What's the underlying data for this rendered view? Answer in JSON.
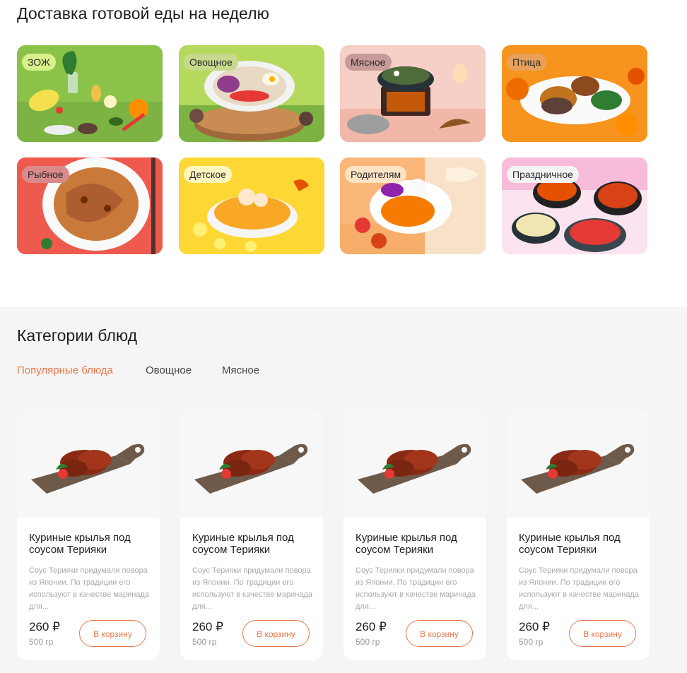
{
  "delivery": {
    "title": "Доставка готовой еды на неделю",
    "categories": [
      {
        "label": "ЗОЖ",
        "tag_color": "#d9f18a",
        "bg": "#8bc34a"
      },
      {
        "label": "Овощное",
        "tag_color": "#c7d98c",
        "bg": "#9ccc4f"
      },
      {
        "label": "Мясное",
        "tag_color": "#c99a9a",
        "bg": "#f4c6c0"
      },
      {
        "label": "Птица",
        "tag_color": "#e8a15a",
        "bg": "#f7941d"
      },
      {
        "label": "Рыбное",
        "tag_color": "#d98a8a",
        "bg": "#ef5a4f"
      },
      {
        "label": "Детское",
        "tag_color": "#fff6c0",
        "bg": "#fdd835"
      },
      {
        "label": "Родителям",
        "tag_color": "#fde3c4",
        "bg": "#fbb77a"
      },
      {
        "label": "Праздничное",
        "tag_color": "#f4f4f4",
        "bg": "#f6cfe2"
      }
    ]
  },
  "dish_categories": {
    "title": "Категории блюд",
    "tabs": [
      {
        "label": "Популярные блюда",
        "active": true
      },
      {
        "label": "Овощное",
        "active": false
      },
      {
        "label": "Мясное",
        "active": false
      }
    ]
  },
  "products": [
    {
      "title": "Куриные крылья под соусом Терияки",
      "description": "Соус Терияки придумали повора из Японии. По традиции его используют в качестве маринада для...",
      "price": "260 ₽",
      "weight": "500 гр",
      "button": "В корзину"
    },
    {
      "title": "Куриные крылья под соусом Терияки",
      "description": "Соус Терияки придумали повора из Японии. По традиции его используют в качестве маринада для...",
      "price": "260 ₽",
      "weight": "500 гр",
      "button": "В корзину"
    },
    {
      "title": "Куриные крылья под соусом Терияки",
      "description": "Соус Терияки придумали повора из Японии. По традиции его используют в качестве маринада для...",
      "price": "260 ₽",
      "weight": "500 гр",
      "button": "В корзину"
    },
    {
      "title": "Куриные крылья под соусом Терияки",
      "description": "Соус Терияки придумали повора из Японии. По традиции его используют в качестве маринада для...",
      "price": "260 ₽",
      "weight": "500 гр",
      "button": "В корзину"
    }
  ],
  "colors": {
    "accent": "#e8784a"
  }
}
